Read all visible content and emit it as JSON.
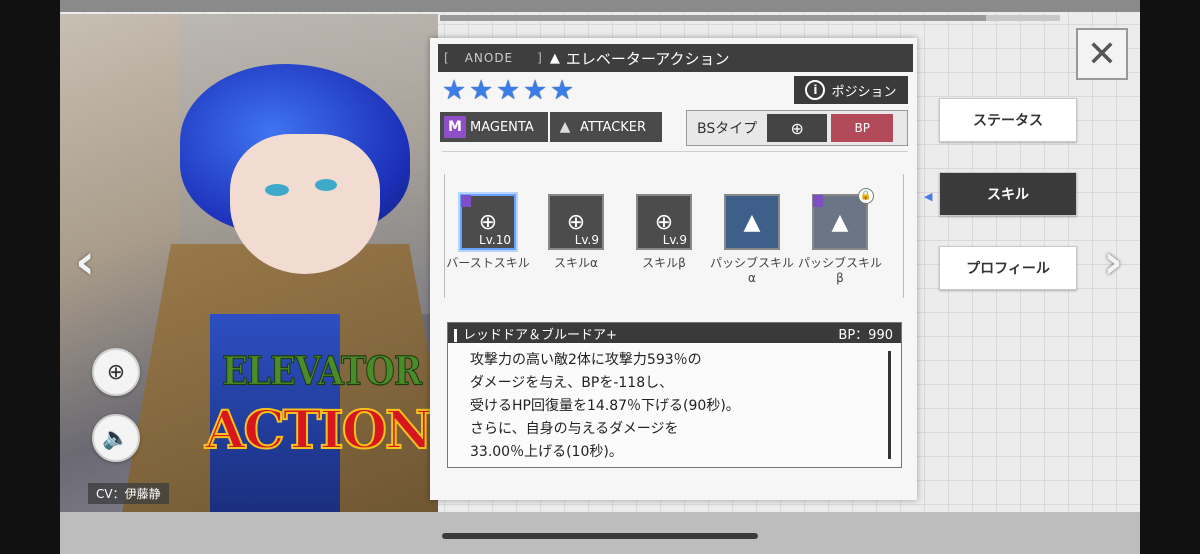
{
  "character": {
    "cv_label": "CV：伊藤静",
    "logo_line1": "ELEVATOR",
    "logo_line2": "ACTION"
  },
  "header": {
    "tag": "ANODE",
    "name": "エレベーターアクション",
    "stars": 5,
    "position_button": "ポジション",
    "type_tag": "MAGENTA",
    "role_tag": "ATTACKER",
    "bs_label": "BSタイプ",
    "bp_icon_text": "BP"
  },
  "skills": [
    {
      "name": "バーストスキル",
      "level": "Lv.10",
      "icon": "target-icon",
      "selected": true
    },
    {
      "name": "スキルα",
      "level": "Lv.9",
      "icon": "target-icon"
    },
    {
      "name": "スキルβ",
      "level": "Lv.9",
      "icon": "target-icon"
    },
    {
      "name": "パッシブスキルα",
      "icon": "arrow-up-icon"
    },
    {
      "name": "パッシブスキルβ",
      "icon": "arrow-up-icon",
      "locked": true
    }
  ],
  "skill_detail": {
    "title": "レッドドア＆ブルードア+",
    "bp": "BP：990",
    "lines": [
      "攻撃力の高い敵2体に攻撃力593％の",
      "ダメージを与え、BPを-118し、",
      "受けるHP回復量を14.87％下げる(90秒)。",
      "さらに、自身の与えるダメージを",
      "33.00％上げる(10秒)。"
    ]
  },
  "menu": {
    "status": "ステータス",
    "skill": "スキル",
    "profile": "プロフィール"
  },
  "colors": {
    "star": "#3b7de8",
    "magenta": "#8e4fc8",
    "bp_button": "#b24a5a",
    "active_menu": "#3a3a3a"
  }
}
